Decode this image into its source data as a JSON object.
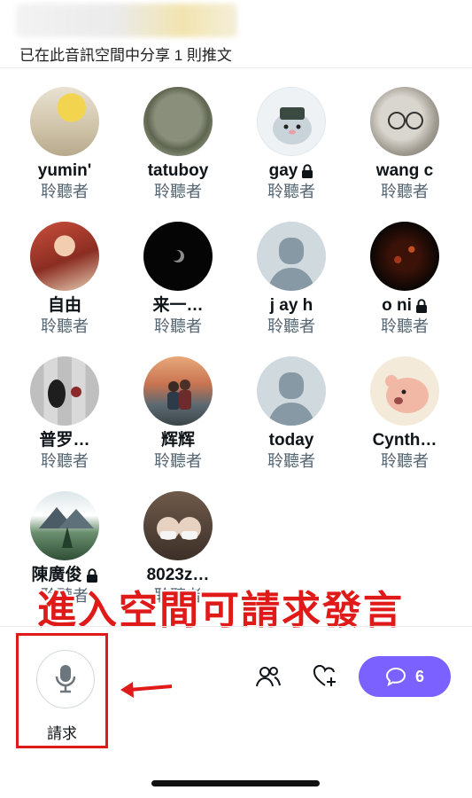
{
  "header": {
    "shared_text": "已在此音訊空間中分享 1 則推文"
  },
  "listeners": [
    {
      "name": "yumin'",
      "role": "聆聽者",
      "locked": false
    },
    {
      "name": "tatuboy",
      "role": "聆聽者",
      "locked": false
    },
    {
      "name": "gay",
      "role": "聆聽者",
      "locked": true
    },
    {
      "name": "wang c",
      "role": "聆聽者",
      "locked": false
    },
    {
      "name": "自由",
      "role": "聆聽者",
      "locked": false
    },
    {
      "name": "来一…",
      "role": "聆聽者",
      "locked": false
    },
    {
      "name": "j ay h",
      "role": "聆聽者",
      "locked": false
    },
    {
      "name": "o ni",
      "role": "聆聽者",
      "locked": true
    },
    {
      "name": "普罗…",
      "role": "聆聽者",
      "locked": false
    },
    {
      "name": "辉辉",
      "role": "聆聽者",
      "locked": false
    },
    {
      "name": "today",
      "role": "聆聽者",
      "locked": false
    },
    {
      "name": "Cynth…",
      "role": "聆聽者",
      "locked": false
    },
    {
      "name": "陳廣俊",
      "role": "聆聽者",
      "locked": true
    },
    {
      "name": "8023z…",
      "role": "聆聽者",
      "locked": false
    }
  ],
  "annotation": {
    "banner": "進入空間可請求發言"
  },
  "bottom_bar": {
    "request_label": "請求",
    "comment_count": "6"
  },
  "colors": {
    "accent": "#7b61ff",
    "highlight_red": "#e01919",
    "secondary_text": "#536471"
  }
}
